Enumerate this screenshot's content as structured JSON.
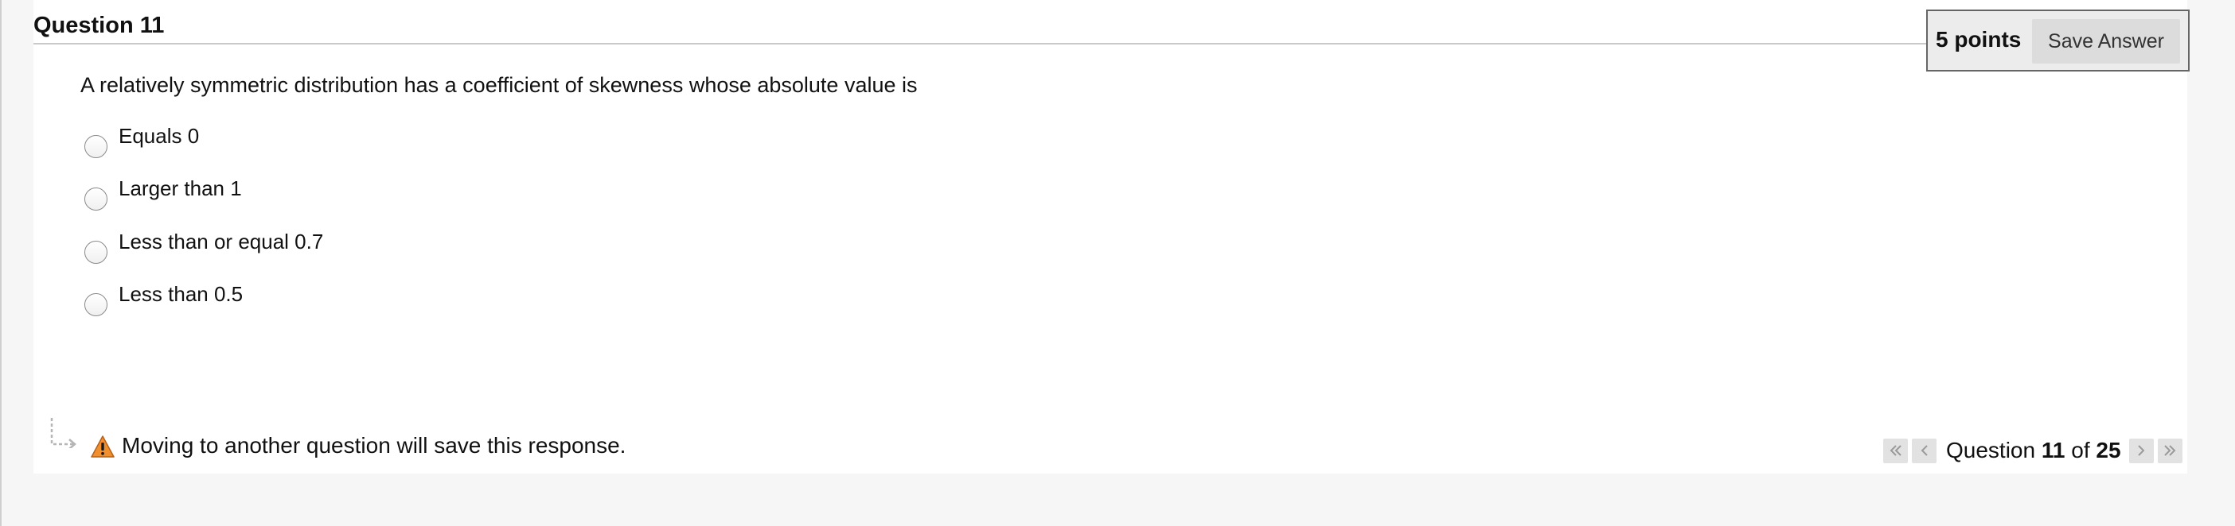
{
  "question": {
    "title": "Question 11",
    "points": "5 points",
    "save_label": "Save Answer",
    "prompt": "A relatively symmetric distribution has a coefficient of skewness whose absolute value is",
    "options": [
      {
        "label": "Equals 0",
        "selected": false
      },
      {
        "label": "Larger than 1",
        "selected": false
      },
      {
        "label": "Less than or equal 0.7",
        "selected": false
      },
      {
        "label": "Less than 0.5",
        "selected": false
      }
    ]
  },
  "footer": {
    "message": "Moving to another question will save this response."
  },
  "nav": {
    "prefix": "Question",
    "current": "11",
    "of_word": "of",
    "total": "25"
  },
  "colors": {
    "warning_orange": "#f0902c",
    "nav_button_bg": "#e2e2e2",
    "save_button_bg": "#dcdcdc"
  },
  "icons": {
    "first": "double-chevron-left-icon",
    "prev": "chevron-left-icon",
    "next": "chevron-right-icon",
    "last": "double-chevron-right-icon",
    "warning": "warning-triangle-icon",
    "footer": "bent-arrow-icon"
  }
}
